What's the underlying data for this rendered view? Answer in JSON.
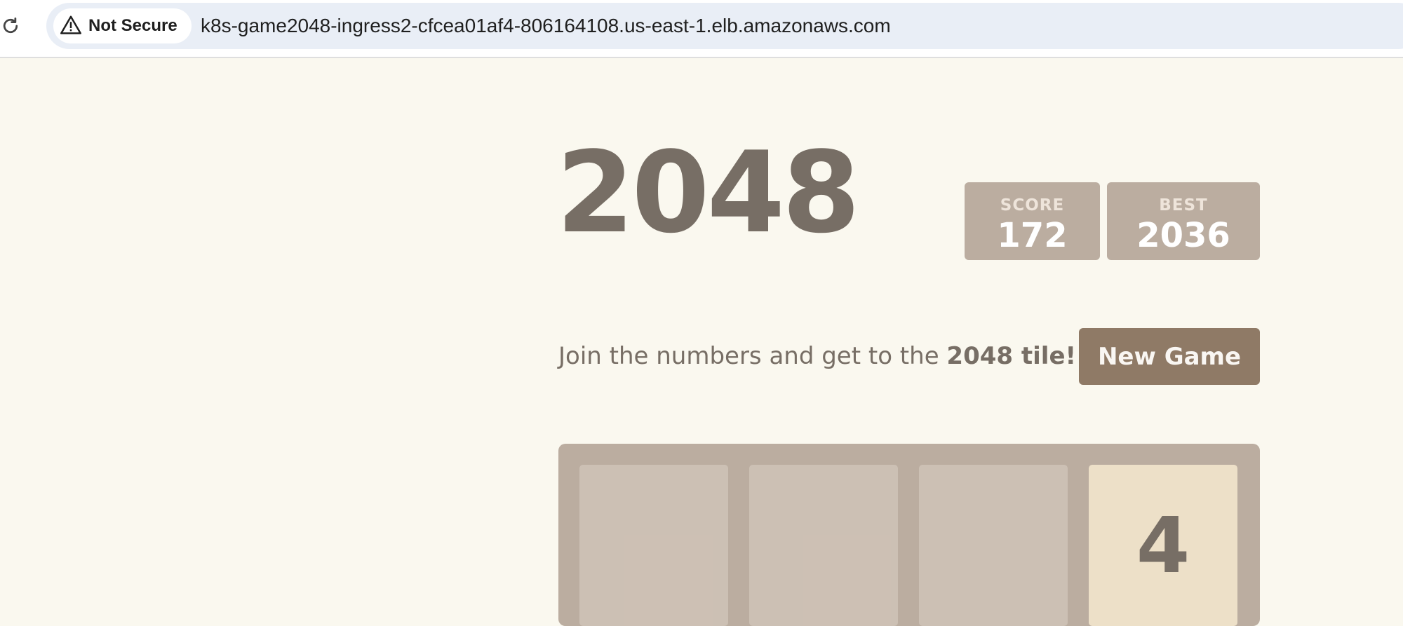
{
  "browser": {
    "security_label": "Not Secure",
    "url": "k8s-game2048-ingress2-cfcea01af4-806164108.us-east-1.elb.amazonaws.com",
    "icons": {
      "reload": "reload-icon",
      "warning": "warning-icon"
    }
  },
  "game": {
    "title": "2048",
    "score_label": "SCORE",
    "score_value": "172",
    "best_label": "BEST",
    "best_value": "2036",
    "intro_text": "Join the numbers and get to the ",
    "intro_bold": "2048 tile!",
    "new_game_label": "New Game",
    "board_row_1": [
      "",
      "",
      "",
      "4"
    ]
  },
  "colors": {
    "background": "#faf8ef",
    "title_text": "#776e65",
    "score_box": "#bbada0",
    "button": "#8f7a66",
    "board": "#bbada0",
    "tile_4": "#ede0c8"
  }
}
